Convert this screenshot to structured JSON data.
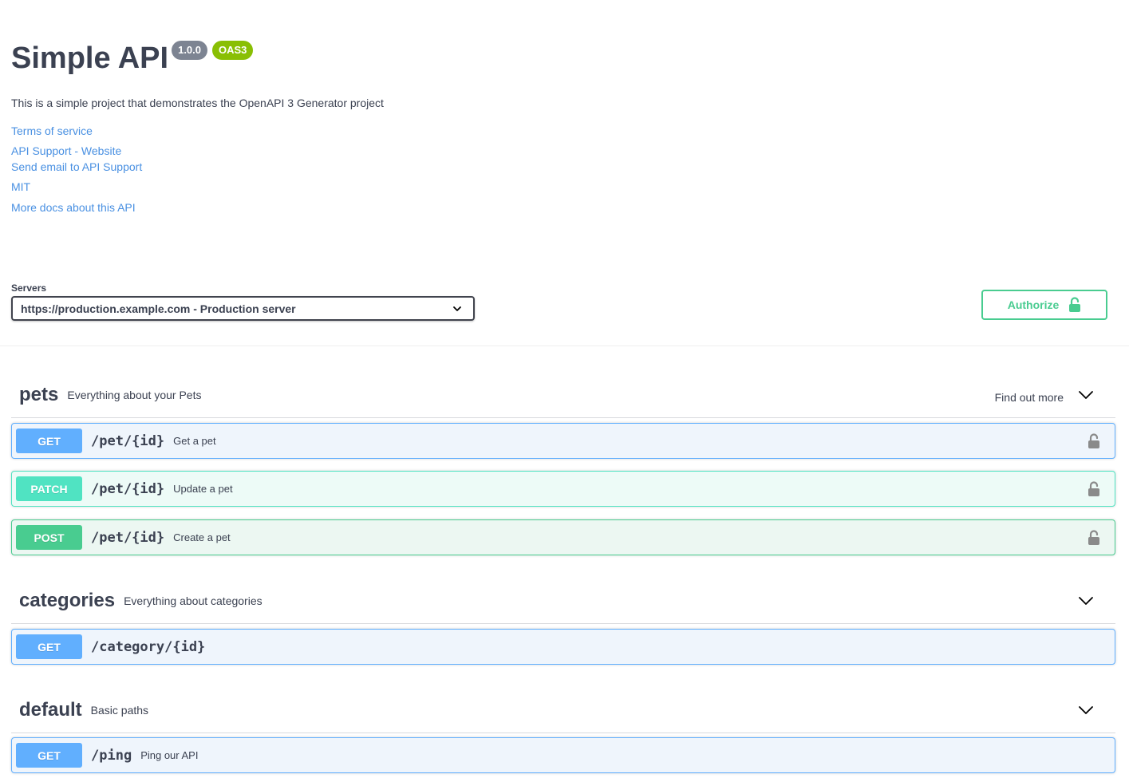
{
  "info": {
    "title": "Simple API",
    "version": "1.0.0",
    "oas_badge": "OAS3",
    "description": "This is a simple project that demonstrates the OpenAPI 3 Generator project",
    "links": {
      "terms": "Terms of service",
      "support_website": "API Support - Website",
      "support_email": "Send email to API Support",
      "license": "MIT",
      "external_docs": "More docs about this API"
    }
  },
  "servers": {
    "label": "Servers",
    "selected": "https://production.example.com - Production server"
  },
  "authorize": {
    "label": "Authorize"
  },
  "colors": {
    "get": "#61affe",
    "patch": "#50e3c2",
    "post": "#49cc90",
    "link": "#4990e2",
    "version_badge": "#7d8492",
    "oas_badge": "#89bf04"
  },
  "tags": [
    {
      "name": "pets",
      "description": "Everything about your Pets",
      "external_link": "Find out more",
      "operations": [
        {
          "method": "GET",
          "path": "/pet/{id}",
          "summary": "Get a pet",
          "locked": true
        },
        {
          "method": "PATCH",
          "path": "/pet/{id}",
          "summary": "Update a pet",
          "locked": true
        },
        {
          "method": "POST",
          "path": "/pet/{id}",
          "summary": "Create a pet",
          "locked": true
        }
      ]
    },
    {
      "name": "categories",
      "description": "Everything about categories",
      "operations": [
        {
          "method": "GET",
          "path": "/category/{id}",
          "summary": "",
          "locked": false
        }
      ]
    },
    {
      "name": "default",
      "description": "Basic paths",
      "operations": [
        {
          "method": "GET",
          "path": "/ping",
          "summary": "Ping our API",
          "locked": false
        }
      ]
    }
  ],
  "icons": {
    "select_chevron": "chevron-down-icon",
    "tag_chevron": "chevron-down-icon",
    "authorize_lock": "unlocked-icon",
    "operation_lock": "lock-icon"
  }
}
